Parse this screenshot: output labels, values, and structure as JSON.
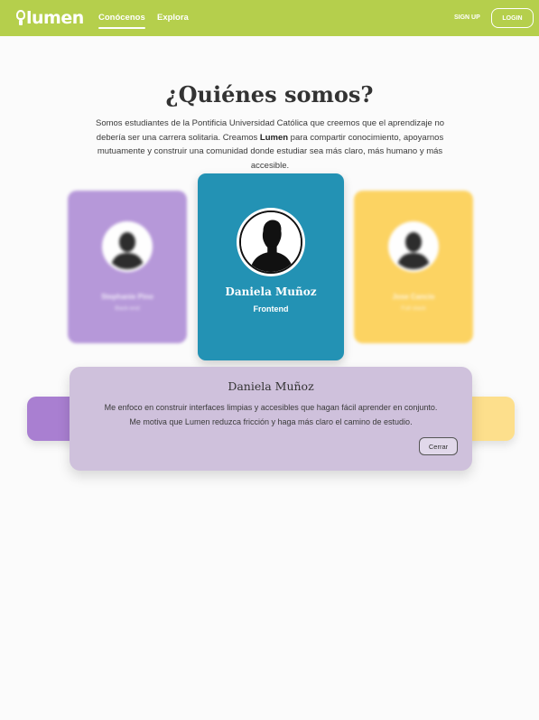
{
  "nav": {
    "logo_text": "lumen",
    "links": [
      {
        "label": "Conócenos",
        "active": true
      },
      {
        "label": "Explora",
        "active": false
      }
    ],
    "signup_label": "SIGN UP",
    "login_label": "LOGIN",
    "bg_color": "#b5cf4c"
  },
  "hero": {
    "title": "¿Quiénes somos?",
    "intro_before": "Somos estudiantes de la Pontificia Universidad Católica que creemos que el aprendizaje no debería ser una carrera solitaria. Creamos ",
    "intro_brand": "Lumen",
    "intro_after": " para compartir conocimiento, apoyarnos mutuamente y construir una comunidad donde estudiar sea más claro, más humano y más accesible."
  },
  "cards": {
    "left": {
      "name": "Stephanie Pino",
      "role": "Back-end",
      "color": "#b393d8",
      "icon": "person-silhouette-icon"
    },
    "main": {
      "name": "Daniela Muñoz",
      "role": "Frontend",
      "color": "#2392b4",
      "icon": "person-silhouette-icon"
    },
    "right": {
      "name": "Jose Cancio",
      "role": "Full stack",
      "color": "#fdd15a",
      "icon": "person-silhouette-icon"
    }
  },
  "modal": {
    "title": "Daniela Muñoz",
    "body_line1": "Me enfoco en construir interfaces limpias y accesibles que hagan fácil aprender en conjunto.",
    "body_line2": "Me motiva que Lumen reduzca fricción y haga más claro el camino de estudio.",
    "close_label": "Cerrar"
  }
}
